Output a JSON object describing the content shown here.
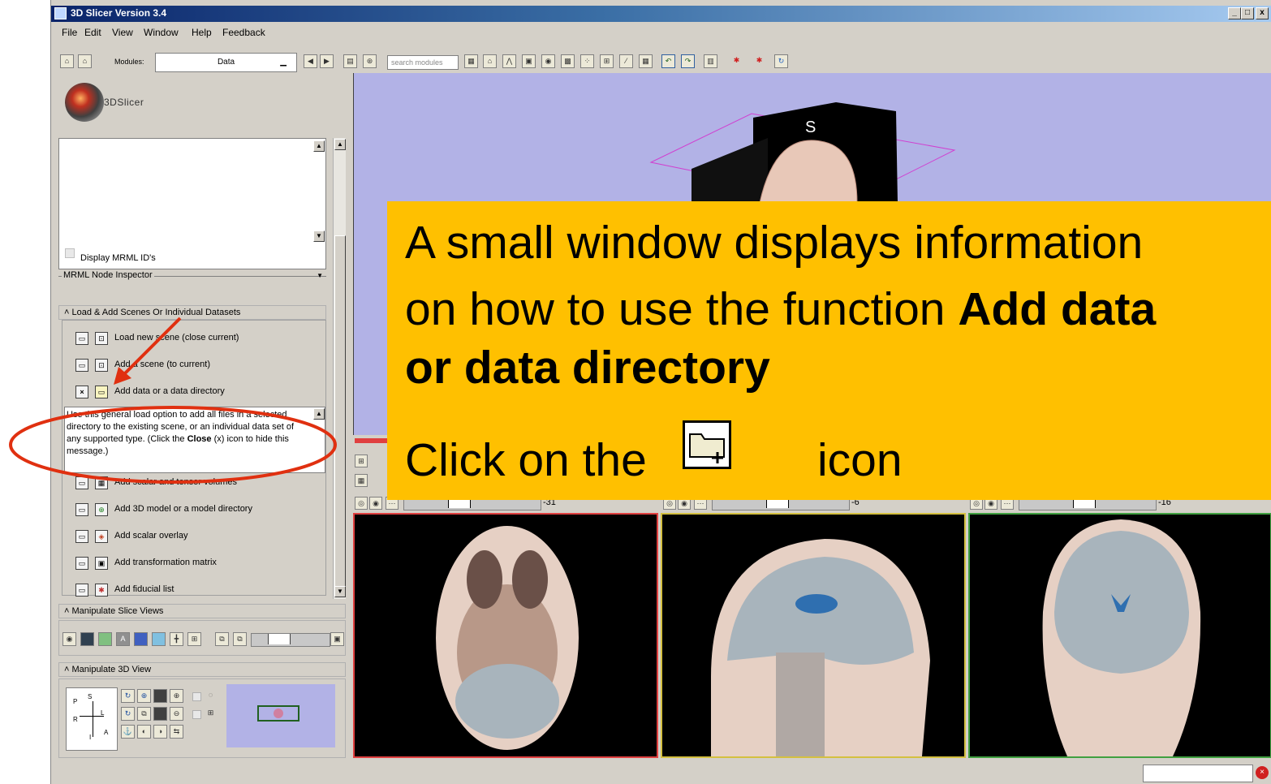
{
  "window": {
    "title": "3D Slicer Version 3.4",
    "controls": [
      "_",
      "□",
      "x"
    ]
  },
  "menu": [
    "File",
    "Edit",
    "View",
    "Window",
    "Help",
    "Feedback"
  ],
  "toolbar": {
    "modules_label": "Modules:",
    "module_value": "Data",
    "search_placeholder": "search modules"
  },
  "logo": {
    "text": "3DSlicer"
  },
  "panel": {
    "display_mrml_ids": "Display MRML ID's",
    "mrml_node_inspector": "MRML Node Inspector",
    "load_section": "Load & Add Scenes Or Individual Datasets",
    "items": [
      "Load new scene (close current)",
      "Add a scene (to current)",
      "Add data or a data directory",
      "Add scalar and tensor volumes",
      "Add 3D model or a model directory",
      "Add scalar overlay",
      "Add transformation matrix",
      "Add fiducial list"
    ],
    "help_text_1": "Use this general load option to add all files in a selected directory to the existing scene, or an individual data set of any supported type. (Click the ",
    "help_text_bold": "Close",
    "help_text_2": " (x) icon to hide this message.)",
    "manipulate_slice": "Manipulate Slice Views",
    "manipulate_3d": "Manipulate 3D View",
    "orientation": {
      "p": "P",
      "s": "S",
      "l": "L",
      "r": "R",
      "i": "I",
      "a": "A"
    }
  },
  "viewer": {
    "s_label": "S"
  },
  "slices": [
    {
      "offset": "-31",
      "border": "#e04040"
    },
    {
      "offset": "-6",
      "border": "#d4c040"
    },
    {
      "offset": "-16",
      "border": "#40a040"
    }
  ],
  "callout": {
    "line1": "A small window displays information",
    "line2a": "on how to use the function ",
    "line2b": "Add data",
    "line3": "or data directory",
    "line4a": "Click on the",
    "line4b": "icon"
  }
}
